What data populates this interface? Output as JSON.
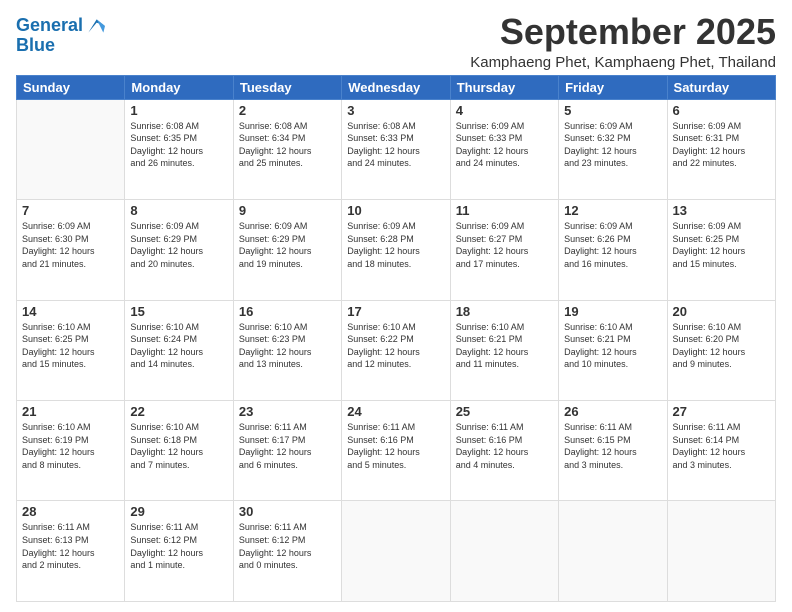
{
  "logo": {
    "line1": "General",
    "line2": "Blue"
  },
  "title": "September 2025",
  "location": "Kamphaeng Phet, Kamphaeng Phet, Thailand",
  "days_header": [
    "Sunday",
    "Monday",
    "Tuesday",
    "Wednesday",
    "Thursday",
    "Friday",
    "Saturday"
  ],
  "weeks": [
    [
      {
        "num": "",
        "info": ""
      },
      {
        "num": "1",
        "info": "Sunrise: 6:08 AM\nSunset: 6:35 PM\nDaylight: 12 hours\nand 26 minutes."
      },
      {
        "num": "2",
        "info": "Sunrise: 6:08 AM\nSunset: 6:34 PM\nDaylight: 12 hours\nand 25 minutes."
      },
      {
        "num": "3",
        "info": "Sunrise: 6:08 AM\nSunset: 6:33 PM\nDaylight: 12 hours\nand 24 minutes."
      },
      {
        "num": "4",
        "info": "Sunrise: 6:09 AM\nSunset: 6:33 PM\nDaylight: 12 hours\nand 24 minutes."
      },
      {
        "num": "5",
        "info": "Sunrise: 6:09 AM\nSunset: 6:32 PM\nDaylight: 12 hours\nand 23 minutes."
      },
      {
        "num": "6",
        "info": "Sunrise: 6:09 AM\nSunset: 6:31 PM\nDaylight: 12 hours\nand 22 minutes."
      }
    ],
    [
      {
        "num": "7",
        "info": "Sunrise: 6:09 AM\nSunset: 6:30 PM\nDaylight: 12 hours\nand 21 minutes."
      },
      {
        "num": "8",
        "info": "Sunrise: 6:09 AM\nSunset: 6:29 PM\nDaylight: 12 hours\nand 20 minutes."
      },
      {
        "num": "9",
        "info": "Sunrise: 6:09 AM\nSunset: 6:29 PM\nDaylight: 12 hours\nand 19 minutes."
      },
      {
        "num": "10",
        "info": "Sunrise: 6:09 AM\nSunset: 6:28 PM\nDaylight: 12 hours\nand 18 minutes."
      },
      {
        "num": "11",
        "info": "Sunrise: 6:09 AM\nSunset: 6:27 PM\nDaylight: 12 hours\nand 17 minutes."
      },
      {
        "num": "12",
        "info": "Sunrise: 6:09 AM\nSunset: 6:26 PM\nDaylight: 12 hours\nand 16 minutes."
      },
      {
        "num": "13",
        "info": "Sunrise: 6:09 AM\nSunset: 6:25 PM\nDaylight: 12 hours\nand 15 minutes."
      }
    ],
    [
      {
        "num": "14",
        "info": "Sunrise: 6:10 AM\nSunset: 6:25 PM\nDaylight: 12 hours\nand 15 minutes."
      },
      {
        "num": "15",
        "info": "Sunrise: 6:10 AM\nSunset: 6:24 PM\nDaylight: 12 hours\nand 14 minutes."
      },
      {
        "num": "16",
        "info": "Sunrise: 6:10 AM\nSunset: 6:23 PM\nDaylight: 12 hours\nand 13 minutes."
      },
      {
        "num": "17",
        "info": "Sunrise: 6:10 AM\nSunset: 6:22 PM\nDaylight: 12 hours\nand 12 minutes."
      },
      {
        "num": "18",
        "info": "Sunrise: 6:10 AM\nSunset: 6:21 PM\nDaylight: 12 hours\nand 11 minutes."
      },
      {
        "num": "19",
        "info": "Sunrise: 6:10 AM\nSunset: 6:21 PM\nDaylight: 12 hours\nand 10 minutes."
      },
      {
        "num": "20",
        "info": "Sunrise: 6:10 AM\nSunset: 6:20 PM\nDaylight: 12 hours\nand 9 minutes."
      }
    ],
    [
      {
        "num": "21",
        "info": "Sunrise: 6:10 AM\nSunset: 6:19 PM\nDaylight: 12 hours\nand 8 minutes."
      },
      {
        "num": "22",
        "info": "Sunrise: 6:10 AM\nSunset: 6:18 PM\nDaylight: 12 hours\nand 7 minutes."
      },
      {
        "num": "23",
        "info": "Sunrise: 6:11 AM\nSunset: 6:17 PM\nDaylight: 12 hours\nand 6 minutes."
      },
      {
        "num": "24",
        "info": "Sunrise: 6:11 AM\nSunset: 6:16 PM\nDaylight: 12 hours\nand 5 minutes."
      },
      {
        "num": "25",
        "info": "Sunrise: 6:11 AM\nSunset: 6:16 PM\nDaylight: 12 hours\nand 4 minutes."
      },
      {
        "num": "26",
        "info": "Sunrise: 6:11 AM\nSunset: 6:15 PM\nDaylight: 12 hours\nand 3 minutes."
      },
      {
        "num": "27",
        "info": "Sunrise: 6:11 AM\nSunset: 6:14 PM\nDaylight: 12 hours\nand 3 minutes."
      }
    ],
    [
      {
        "num": "28",
        "info": "Sunrise: 6:11 AM\nSunset: 6:13 PM\nDaylight: 12 hours\nand 2 minutes."
      },
      {
        "num": "29",
        "info": "Sunrise: 6:11 AM\nSunset: 6:12 PM\nDaylight: 12 hours\nand 1 minute."
      },
      {
        "num": "30",
        "info": "Sunrise: 6:11 AM\nSunset: 6:12 PM\nDaylight: 12 hours\nand 0 minutes."
      },
      {
        "num": "",
        "info": ""
      },
      {
        "num": "",
        "info": ""
      },
      {
        "num": "",
        "info": ""
      },
      {
        "num": "",
        "info": ""
      }
    ]
  ]
}
